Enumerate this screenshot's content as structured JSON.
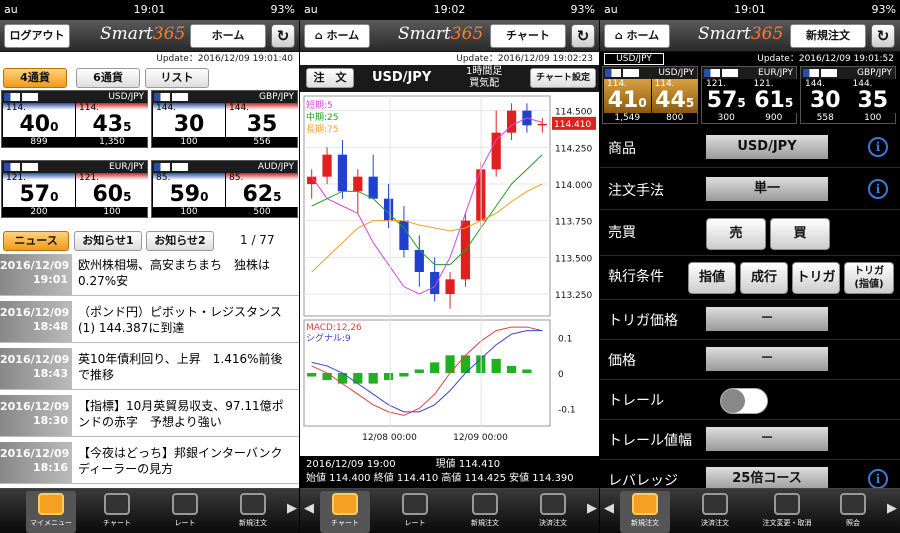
{
  "status": {
    "carrier": "au",
    "battery": "93%",
    "times": [
      "19:01",
      "19:02",
      "19:01"
    ]
  },
  "brand": {
    "part1": "Smart",
    "part2": "365"
  },
  "p1": {
    "logout": "ログアウト",
    "home": "ホーム",
    "update": "Update：2016/12/09 19:01:40",
    "tabs": [
      "4通貨",
      "6通貨",
      "リスト"
    ],
    "quotes": [
      {
        "pair": "USD/JPY",
        "bid_pre": "114.",
        "bid": "40",
        "bid_s": "0",
        "ask_pre": "114.",
        "ask": "43",
        "ask_s": "5",
        "left": "899",
        "right": "1,350"
      },
      {
        "pair": "GBP/JPY",
        "bid_pre": "144.",
        "bid": "30",
        "bid_s": "",
        "ask_pre": "144.",
        "ask": "35",
        "ask_s": "",
        "left": "100",
        "right": "556"
      },
      {
        "pair": "EUR/JPY",
        "bid_pre": "121.",
        "bid": "57",
        "bid_s": "0",
        "ask_pre": "121.",
        "ask": "60",
        "ask_s": "5",
        "left": "200",
        "right": "100"
      },
      {
        "pair": "AUD/JPY",
        "bid_pre": "85.",
        "bid": "59",
        "bid_s": "0",
        "ask_pre": "85.",
        "ask": "62",
        "ask_s": "5",
        "left": "100",
        "right": "500"
      }
    ],
    "news_tabs": [
      "ニュース",
      "お知らせ1",
      "お知らせ2"
    ],
    "news_count": "1 / 77",
    "news": [
      {
        "date": "2016/12/09",
        "time": "19:01",
        "title": "欧州株相場、高安まちまち　独株は0.27%安"
      },
      {
        "date": "2016/12/09",
        "time": "18:48",
        "title": "（ポンド円）ピボット・レジスタンス(1) 144.387に到達"
      },
      {
        "date": "2016/12/09",
        "time": "18:43",
        "title": "英10年債利回り、上昇　1.416%前後で推移"
      },
      {
        "date": "2016/12/09",
        "time": "18:30",
        "title": "【指標】10月英貿易収支、97.11億ポンドの赤字　予想より強い"
      },
      {
        "date": "2016/12/09",
        "time": "18:16",
        "title": "【今夜はどっち】邦銀インターバンクディーラーの見方"
      }
    ],
    "tabbar": [
      "マイメニュー",
      "チャート",
      "レート",
      "新規注文"
    ]
  },
  "p2": {
    "home": "ホーム",
    "title_btn": "チャート",
    "update": "Update：2016/12/09 19:02:23",
    "order_btn": "注　文",
    "pair": "USD/JPY",
    "period": "1時間足",
    "side": "買気配",
    "settings_btn": "チャート設定",
    "ma": {
      "short": "短期:5",
      "mid": "中期:25",
      "long": "長期:75"
    },
    "price_ticks": [
      "114.500",
      "114.250",
      "114.000",
      "113.750",
      "113.500",
      "113.250"
    ],
    "current_tag": "114.410",
    "macd_labels": {
      "macd": "MACD:12,26",
      "signal": "シグナル:9"
    },
    "macd_ticks": [
      "0.1",
      "0",
      "-0.1"
    ],
    "x_ticks": [
      "12/08 00:00",
      "12/09 00:00"
    ],
    "info": {
      "datetime": "2016/12/09 19:00",
      "current": "現値 114.410",
      "line2": "始値 114.400 終値 114.410 高値 114.425 安値 114.390"
    },
    "tabbar": [
      "チャート",
      "レート",
      "新規注文",
      "決済注文"
    ]
  },
  "p3": {
    "home": "ホーム",
    "title_btn": "新規注文",
    "update": "Update：2016/12/09 19:01:52",
    "pair_label": "USD/JPY",
    "quotes": [
      {
        "pair": "USD/JPY",
        "bid_pre": "114.",
        "bid": "41",
        "bid_s": "0",
        "ask_pre": "114.",
        "ask": "44",
        "ask_s": "5",
        "left": "1,549",
        "right": "800"
      },
      {
        "pair": "EUR/JPY",
        "bid_pre": "121.",
        "bid": "57",
        "bid_s": "5",
        "ask_pre": "121.",
        "ask": "61",
        "ask_s": "5",
        "left": "300",
        "right": "900"
      },
      {
        "pair": "GBP/JPY",
        "bid_pre": "144.",
        "bid": "30",
        "bid_s": "",
        "ask_pre": "144.",
        "ask": "35",
        "ask_s": "",
        "left": "558",
        "right": "100"
      }
    ],
    "rows": {
      "product_label": "商品",
      "product_value": "USD/JPY",
      "method_label": "注文手法",
      "method_value": "単一",
      "side_label": "売買",
      "sell": "売",
      "buy": "買",
      "cond_label": "執行条件",
      "cond_opts": [
        "指値",
        "成行",
        "トリガ"
      ],
      "cond_extra1": "トリガ",
      "cond_extra2": "(指値)",
      "trigger_label": "トリガ価格",
      "trigger_value": "－",
      "price_label": "価格",
      "price_value": "－",
      "trail_label": "トレール",
      "trailw_label": "トレール値幅",
      "trailw_value": "－",
      "lev_label": "レバレッジ",
      "lev_value": "25倍コース"
    },
    "tabbar": [
      "新規注文",
      "決済注文",
      "注文変更・取消",
      "照会"
    ]
  },
  "colors": {
    "accent": "#f5a020",
    "bid": "#2a4ea8",
    "ask": "#d02020"
  },
  "chart_data": [
    {
      "type": "line",
      "title": "USD/JPY 1時間足",
      "x_ticks": [
        "12/08 00:00",
        "12/09 00:00"
      ],
      "ylim": [
        113.1,
        114.6
      ],
      "series": [
        {
          "name": "短期:5",
          "values": [
            114.05,
            113.9,
            113.85,
            113.8,
            113.6,
            113.45,
            113.3,
            113.25,
            113.3,
            113.5,
            113.8,
            114.1,
            114.3,
            114.4,
            114.45,
            114.42
          ]
        },
        {
          "name": "中期:25",
          "values": [
            113.85,
            113.9,
            113.95,
            113.95,
            113.9,
            113.8,
            113.7,
            113.55,
            113.45,
            113.45,
            113.55,
            113.7,
            113.85,
            114.0,
            114.1,
            114.2
          ]
        },
        {
          "name": "長期:75",
          "values": [
            113.4,
            113.5,
            113.6,
            113.7,
            113.75,
            113.75,
            113.75,
            113.72,
            113.7,
            113.68,
            113.7,
            113.75,
            113.8,
            113.88,
            113.95,
            114.0
          ]
        }
      ],
      "candles": [
        [
          114.0,
          114.1,
          113.9,
          114.05
        ],
        [
          114.05,
          114.25,
          114.0,
          114.2
        ],
        [
          114.2,
          114.3,
          113.9,
          113.95
        ],
        [
          113.95,
          114.1,
          113.8,
          114.05
        ],
        [
          114.05,
          114.2,
          113.9,
          113.9
        ],
        [
          113.9,
          114.0,
          113.7,
          113.75
        ],
        [
          113.75,
          113.85,
          113.5,
          113.55
        ],
        [
          113.55,
          113.65,
          113.3,
          113.4
        ],
        [
          113.4,
          113.5,
          113.2,
          113.25
        ],
        [
          113.25,
          113.4,
          113.15,
          113.35
        ],
        [
          113.35,
          113.8,
          113.3,
          113.75
        ],
        [
          113.75,
          114.15,
          113.7,
          114.1
        ],
        [
          114.1,
          114.5,
          114.05,
          114.35
        ],
        [
          114.35,
          114.55,
          114.3,
          114.5
        ],
        [
          114.5,
          114.55,
          114.35,
          114.4
        ],
        [
          114.4,
          114.45,
          114.35,
          114.41
        ]
      ],
      "current": 114.41
    },
    {
      "type": "line",
      "title": "MACD",
      "ylim": [
        -0.15,
        0.15
      ],
      "series": [
        {
          "name": "MACD:12,26",
          "values": [
            0.02,
            0.0,
            -0.03,
            -0.06,
            -0.09,
            -0.11,
            -0.12,
            -0.1,
            -0.06,
            0.0,
            0.05,
            0.09,
            0.12,
            0.13,
            0.13,
            0.12
          ]
        },
        {
          "name": "シグナル:9",
          "values": [
            0.03,
            0.02,
            0.0,
            -0.03,
            -0.06,
            -0.09,
            -0.11,
            -0.11,
            -0.09,
            -0.05,
            0.0,
            0.04,
            0.08,
            0.11,
            0.12,
            0.12
          ]
        }
      ],
      "histogram": [
        -0.01,
        -0.02,
        -0.03,
        -0.03,
        -0.03,
        -0.02,
        -0.01,
        0.01,
        0.03,
        0.05,
        0.05,
        0.05,
        0.04,
        0.02,
        0.01,
        0.0
      ]
    }
  ]
}
